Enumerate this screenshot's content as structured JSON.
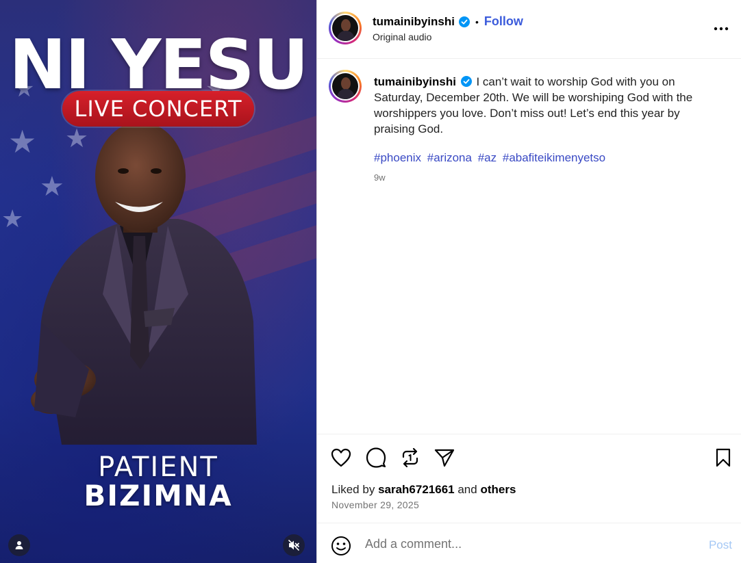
{
  "post": {
    "media": {
      "title": "NI YESU",
      "subtitle": "LIVE CONCERT",
      "name_line1": "PATIENT",
      "name_line2": "BIZIMNA",
      "user_tag_icon": "person-icon",
      "mute_icon": "speaker-muted-icon"
    },
    "author": {
      "username": "tumainibyinshi",
      "verified": true,
      "separator": "•",
      "follow_label": "Follow",
      "audio_label": "Original audio"
    },
    "caption": {
      "username": "tumainibyinshi",
      "text": "I can’t wait to worship God with you on Saturday, December 20th. We will be worshiping God with the worshippers you love. Don’t miss out! Let’s end this year by praising God.",
      "hashtags": [
        "#phoenix",
        "#arizona",
        "#az",
        "#abafiteikimenyetso"
      ],
      "age": "9w"
    },
    "actions": {
      "like_icon": "heart-icon",
      "comment_icon": "comment-icon",
      "repost_icon": "repost-icon",
      "share_icon": "send-icon",
      "save_icon": "bookmark-icon"
    },
    "likes": {
      "prefix": "Liked by",
      "user": "sarah6721661",
      "and": "and",
      "others": "others"
    },
    "date": "November 29, 2025",
    "comment": {
      "placeholder": "Add a comment...",
      "post_label": "Post"
    },
    "colors": {
      "link": "#3b5bdb",
      "hashtag": "#3949c4",
      "post_disabled": "#a5c8f5",
      "verified": "#0095f6"
    }
  }
}
